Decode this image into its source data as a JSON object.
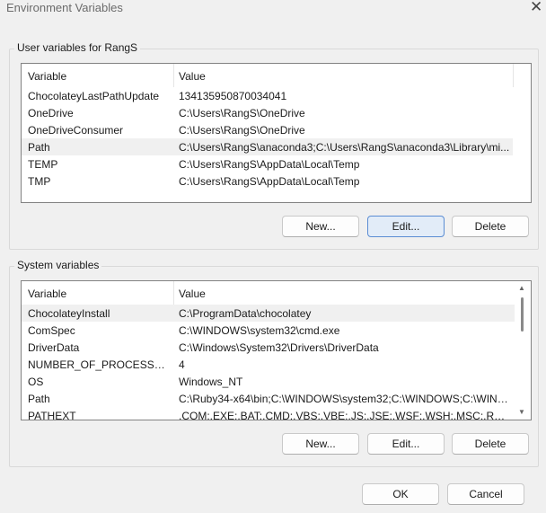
{
  "window": {
    "title": "Environment Variables",
    "close_glyph": "✕"
  },
  "user_vars": {
    "group_label": "User variables for RangS",
    "columns": [
      "Variable",
      "Value"
    ],
    "rows": [
      {
        "name": "ChocolateyLastPathUpdate",
        "value": "134135950870034041"
      },
      {
        "name": "OneDrive",
        "value": "C:\\Users\\RangS\\OneDrive"
      },
      {
        "name": "OneDriveConsumer",
        "value": "C:\\Users\\RangS\\OneDrive"
      },
      {
        "name": "Path",
        "value": "C:\\Users\\RangS\\anaconda3;C:\\Users\\RangS\\anaconda3\\Library\\mi..."
      },
      {
        "name": "TEMP",
        "value": "C:\\Users\\RangS\\AppData\\Local\\Temp"
      },
      {
        "name": "TMP",
        "value": "C:\\Users\\RangS\\AppData\\Local\\Temp"
      }
    ],
    "selected_index": 3,
    "buttons": {
      "new": "New...",
      "edit": "Edit...",
      "delete": "Delete"
    }
  },
  "system_vars": {
    "group_label": "System variables",
    "columns": [
      "Variable",
      "Value"
    ],
    "rows": [
      {
        "name": "ChocolateyInstall",
        "value": "C:\\ProgramData\\chocolatey"
      },
      {
        "name": "ComSpec",
        "value": "C:\\WINDOWS\\system32\\cmd.exe"
      },
      {
        "name": "DriverData",
        "value": "C:\\Windows\\System32\\Drivers\\DriverData"
      },
      {
        "name": "NUMBER_OF_PROCESSORS",
        "value": "4"
      },
      {
        "name": "OS",
        "value": "Windows_NT"
      },
      {
        "name": "Path",
        "value": "C:\\Ruby34-x64\\bin;C:\\WINDOWS\\system32;C:\\WINDOWS;C:\\WIND..."
      },
      {
        "name": "PATHEXT",
        "value": ".COM;.EXE;.BAT;.CMD;.VBS;.VBE;.JS;.JSE;.WSF;.WSH;.MSC;.RB;.RBW"
      }
    ],
    "selected_index": 0,
    "buttons": {
      "new": "New...",
      "edit": "Edit...",
      "delete": "Delete"
    }
  },
  "footer": {
    "ok": "OK",
    "cancel": "Cancel"
  }
}
